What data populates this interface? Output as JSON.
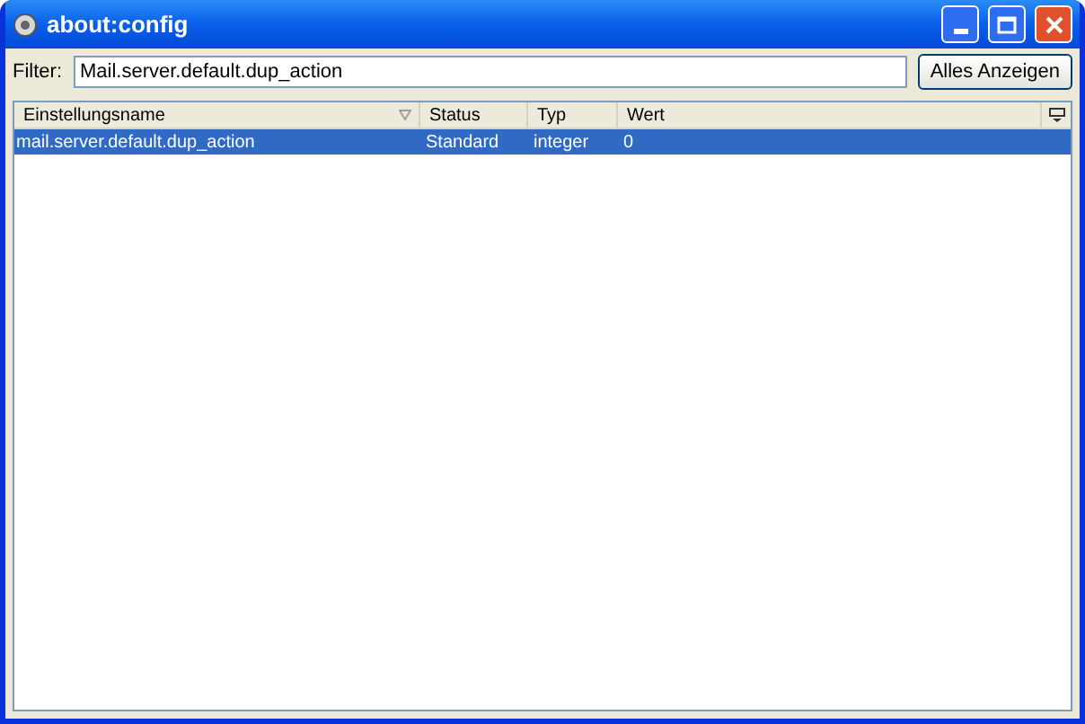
{
  "window": {
    "title": "about:config"
  },
  "filter": {
    "label": "Filter:",
    "value": "Mail.server.default.dup_action"
  },
  "show_all_button": "Alles Anzeigen",
  "table": {
    "columns": [
      {
        "label": "Einstellungsname",
        "sorted": true
      },
      {
        "label": "Status",
        "sorted": false
      },
      {
        "label": "Typ",
        "sorted": false
      },
      {
        "label": "Wert",
        "sorted": false
      }
    ],
    "rows": [
      {
        "cells": [
          "mail.server.default.dup_action",
          "Standard",
          "integer",
          "0"
        ],
        "selected": true
      }
    ]
  }
}
